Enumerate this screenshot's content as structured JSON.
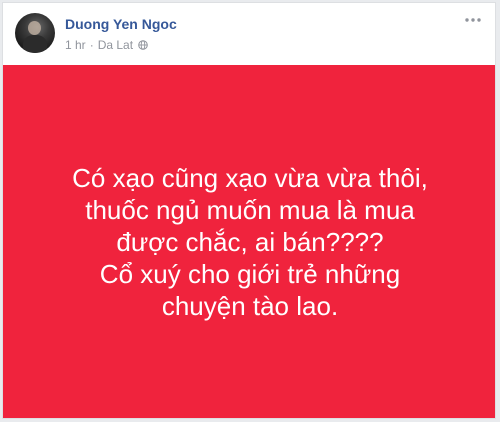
{
  "post": {
    "author": "Duong Yen Ngoc",
    "time": "1 hr",
    "separator": "·",
    "location": "Da Lat",
    "privacy_icon": "globe-icon",
    "more_icon": "more-options-icon",
    "background_color": "#f0233d",
    "text_color": "#ffffff",
    "lines": [
      "Có xạo cũng xạo vừa vừa thôi,",
      "thuốc ngủ muốn mua là mua",
      "được chắc, ai bán????",
      "Cổ xuý cho giới trẻ những",
      "chuyện tào lao."
    ]
  }
}
